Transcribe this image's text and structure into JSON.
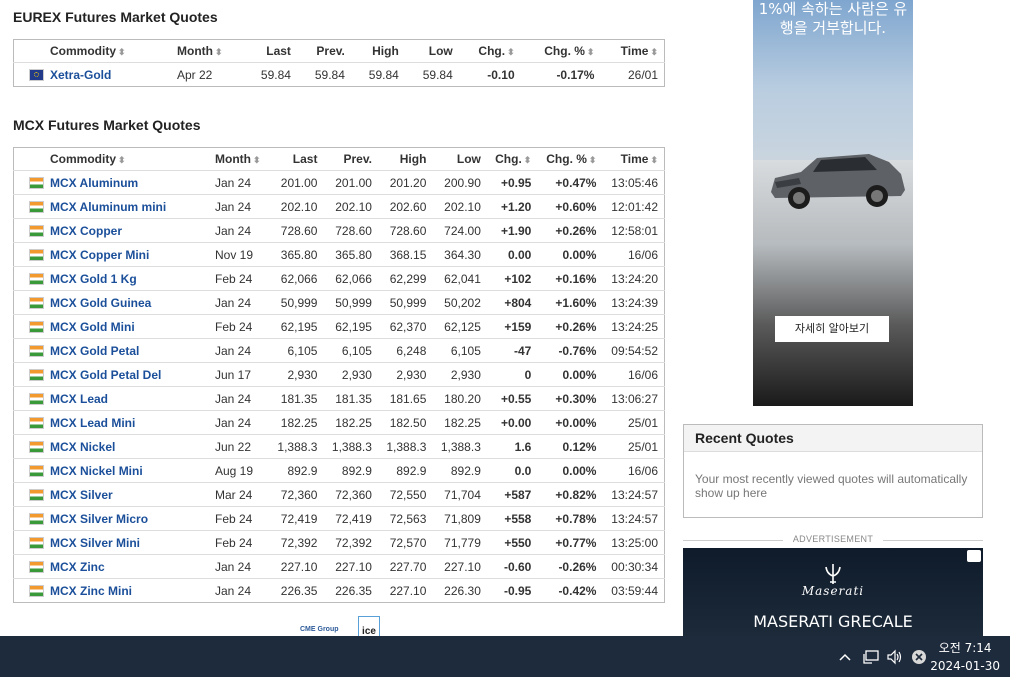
{
  "eurex": {
    "title": "EUREX Futures Market Quotes",
    "headers": {
      "commodity": "Commodity",
      "month": "Month",
      "last": "Last",
      "prev": "Prev.",
      "high": "High",
      "low": "Low",
      "chg": "Chg.",
      "chgpct": "Chg. %",
      "time": "Time"
    },
    "rows": [
      {
        "name": "Xetra-Gold",
        "month": "Apr 22",
        "last": "59.84",
        "prev": "59.84",
        "high": "59.84",
        "low": "59.84",
        "chg": "-0.10",
        "chgpct": "-0.17%",
        "time": "26/01",
        "dir": "neg"
      }
    ]
  },
  "mcx": {
    "title": "MCX Futures Market Quotes",
    "headers": {
      "commodity": "Commodity",
      "month": "Month",
      "last": "Last",
      "prev": "Prev.",
      "high": "High",
      "low": "Low",
      "chg": "Chg.",
      "chgpct": "Chg. %",
      "time": "Time"
    },
    "rows": [
      {
        "name": "MCX Aluminum",
        "month": "Jan 24",
        "last": "201.00",
        "prev": "201.00",
        "high": "201.20",
        "low": "200.90",
        "chg": "+0.95",
        "chgpct": "+0.47%",
        "time": "13:05:46",
        "dir": "pos"
      },
      {
        "name": "MCX Aluminum mini",
        "month": "Jan 24",
        "last": "202.10",
        "prev": "202.10",
        "high": "202.60",
        "low": "202.10",
        "chg": "+1.20",
        "chgpct": "+0.60%",
        "time": "12:01:42",
        "dir": "pos"
      },
      {
        "name": "MCX Copper",
        "month": "Jan 24",
        "last": "728.60",
        "prev": "728.60",
        "high": "728.60",
        "low": "724.00",
        "chg": "+1.90",
        "chgpct": "+0.26%",
        "time": "12:58:01",
        "dir": "pos"
      },
      {
        "name": "MCX Copper Mini",
        "month": "Nov 19",
        "last": "365.80",
        "prev": "365.80",
        "high": "368.15",
        "low": "364.30",
        "chg": "0.00",
        "chgpct": "0.00%",
        "time": "16/06",
        "dir": "zero"
      },
      {
        "name": "MCX Gold 1 Kg",
        "month": "Feb 24",
        "last": "62,066",
        "prev": "62,066",
        "high": "62,299",
        "low": "62,041",
        "chg": "+102",
        "chgpct": "+0.16%",
        "time": "13:24:20",
        "dir": "pos"
      },
      {
        "name": "MCX Gold Guinea",
        "month": "Jan 24",
        "last": "50,999",
        "prev": "50,999",
        "high": "50,999",
        "low": "50,202",
        "chg": "+804",
        "chgpct": "+1.60%",
        "time": "13:24:39",
        "dir": "pos"
      },
      {
        "name": "MCX Gold Mini",
        "month": "Feb 24",
        "last": "62,195",
        "prev": "62,195",
        "high": "62,370",
        "low": "62,125",
        "chg": "+159",
        "chgpct": "+0.26%",
        "time": "13:24:25",
        "dir": "pos"
      },
      {
        "name": "MCX Gold Petal",
        "month": "Jan 24",
        "last": "6,105",
        "prev": "6,105",
        "high": "6,248",
        "low": "6,105",
        "chg": "-47",
        "chgpct": "-0.76%",
        "time": "09:54:52",
        "dir": "neg"
      },
      {
        "name": "MCX Gold Petal Del",
        "month": "Jun 17",
        "last": "2,930",
        "prev": "2,930",
        "high": "2,930",
        "low": "2,930",
        "chg": "0",
        "chgpct": "0.00%",
        "time": "16/06",
        "dir": "zero"
      },
      {
        "name": "MCX Lead",
        "month": "Jan 24",
        "last": "181.35",
        "prev": "181.35",
        "high": "181.65",
        "low": "180.20",
        "chg": "+0.55",
        "chgpct": "+0.30%",
        "time": "13:06:27",
        "dir": "pos"
      },
      {
        "name": "MCX Lead Mini",
        "month": "Jan 24",
        "last": "182.25",
        "prev": "182.25",
        "high": "182.50",
        "low": "182.25",
        "chg": "+0.00",
        "chgpct": "+0.00%",
        "time": "25/01",
        "dir": "pos"
      },
      {
        "name": "MCX Nickel",
        "month": "Jun 22",
        "last": "1,388.3",
        "prev": "1,388.3",
        "high": "1,388.3",
        "low": "1,388.3",
        "chg": "1.6",
        "chgpct": "0.12%",
        "time": "25/01",
        "dir": "neg"
      },
      {
        "name": "MCX Nickel Mini",
        "month": "Aug 19",
        "last": "892.9",
        "prev": "892.9",
        "high": "892.9",
        "low": "892.9",
        "chg": "0.0",
        "chgpct": "0.00%",
        "time": "16/06",
        "dir": "zero"
      },
      {
        "name": "MCX Silver",
        "month": "Mar 24",
        "last": "72,360",
        "prev": "72,360",
        "high": "72,550",
        "low": "71,704",
        "chg": "+587",
        "chgpct": "+0.82%",
        "time": "13:24:57",
        "dir": "pos"
      },
      {
        "name": "MCX Silver Micro",
        "month": "Feb 24",
        "last": "72,419",
        "prev": "72,419",
        "high": "72,563",
        "low": "71,809",
        "chg": "+558",
        "chgpct": "+0.78%",
        "time": "13:24:57",
        "dir": "pos"
      },
      {
        "name": "MCX Silver Mini",
        "month": "Feb 24",
        "last": "72,392",
        "prev": "72,392",
        "high": "72,570",
        "low": "71,779",
        "chg": "+550",
        "chgpct": "+0.77%",
        "time": "13:25:00",
        "dir": "pos"
      },
      {
        "name": "MCX Zinc",
        "month": "Jan 24",
        "last": "227.10",
        "prev": "227.10",
        "high": "227.70",
        "low": "227.10",
        "chg": "-0.60",
        "chgpct": "-0.26%",
        "time": "00:30:34",
        "dir": "neg"
      },
      {
        "name": "MCX Zinc Mini",
        "month": "Jan 24",
        "last": "226.35",
        "prev": "226.35",
        "high": "227.10",
        "low": "226.30",
        "chg": "-0.95",
        "chgpct": "-0.42%",
        "time": "03:59:44",
        "dir": "neg"
      }
    ]
  },
  "ad_top": {
    "text": "1%에 속하는 사람은 유행을 거부합니다.",
    "button": "자세히 알아보기"
  },
  "recent": {
    "title": "Recent Quotes",
    "body": "Your most recently viewed quotes will automatically show up here"
  },
  "ad_bottom": {
    "label": "ADVERTISEMENT",
    "brand": "Maserati",
    "model": "MASERATI GRECALE"
  },
  "logos": {
    "cme": "CME Group",
    "ice": "ice"
  },
  "colors": {
    "positive": "#1a9a1a",
    "negative": "#d00000",
    "link": "#1b4f9a",
    "taskbar": "#1e2b3c"
  },
  "taskbar": {
    "time": "오전 7:14",
    "date": "2024-01-30",
    "icons": [
      "chevron-up-icon",
      "network-icon",
      "volume-icon",
      "close-circle-icon"
    ]
  }
}
